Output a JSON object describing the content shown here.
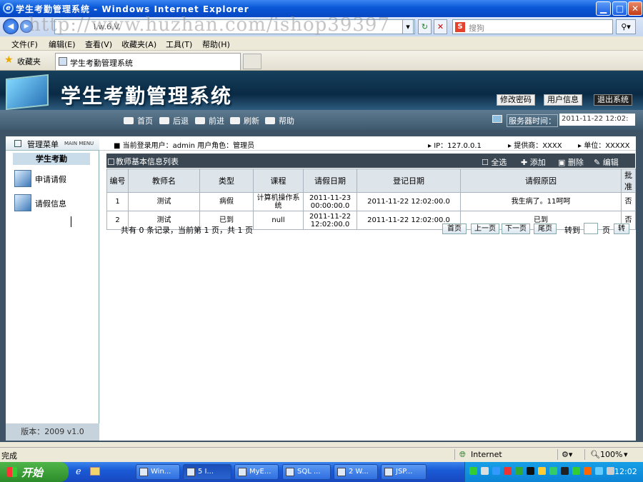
{
  "window": {
    "title": "学生考勤管理系统 - Windows Internet Explorer",
    "min_glyph": "▁",
    "max_glyph": "□",
    "close_glyph": "✕"
  },
  "browser": {
    "address": "l.w.6.V.",
    "search_placeholder": "搜狗",
    "search_logo": "S",
    "watermark": "http://www.huzhan.com/ishop39397",
    "menu": [
      "文件(F)",
      "编辑(E)",
      "查看(V)",
      "收藏夹(A)",
      "工具(T)",
      "帮助(H)"
    ],
    "favorites_label": "收藏夹",
    "tab_title": "学生考勤管理系统",
    "status_left": "完成",
    "status_zone": "Internet",
    "zoom": "100%"
  },
  "app": {
    "title": "学生考勤管理系统",
    "header_buttons": [
      "修改密码",
      "用户信息",
      "退出系统"
    ],
    "nav": [
      "首页",
      "后退",
      "前进",
      "刷新",
      "帮助"
    ],
    "server_time_label": "服务器时间：",
    "server_time_value": "2011-11-22 12:02:",
    "sidebar": {
      "title": "管理菜单",
      "title_en": "MAIN MENU",
      "section": "学生考勤",
      "items": [
        "申请请假",
        "请假信息"
      ],
      "version": "版本：2009 v1.0"
    },
    "topinfo": {
      "user": "■ 当前登录用户：admin  用户角色：管理员",
      "ip": "▸ IP：127.0.0.1",
      "provider": "▸ 提供商：XXXX",
      "unit": "▸ 单位：XXXXX"
    },
    "list": {
      "title": "教师基本信息列表",
      "actions": [
        "全选",
        "添加",
        "删除",
        "编辑"
      ],
      "columns": [
        "编号",
        "教师名",
        "类型",
        "课程",
        "请假日期",
        "登记日期",
        "请假原因",
        "批准"
      ],
      "rows": [
        [
          "1",
          "测试",
          "病假",
          "计算机操作系统",
          "2011-11-23 00:00:00.0",
          "2011-11-22 12:02:00.0",
          "我生病了。11呵呵",
          "否"
        ],
        [
          "2",
          "测试",
          "已到",
          "null",
          "2011-11-22 12:02:00.0",
          "2011-11-22 12:02:00.0",
          "已到",
          "否"
        ]
      ]
    },
    "pager": {
      "info": "共有 0 条记录，当前第 1 页，共 1 页",
      "buttons": [
        "首页",
        "上一页",
        "下一页",
        "尾页"
      ],
      "goto": "转到",
      "page_unit": "页",
      "go": "转"
    }
  },
  "taskbar": {
    "start": "开始",
    "buttons": [
      "Win...",
      "5 I...",
      "MyE...",
      "SQL ...",
      "2 W...",
      "JSP..."
    ],
    "clock": "12:02"
  }
}
